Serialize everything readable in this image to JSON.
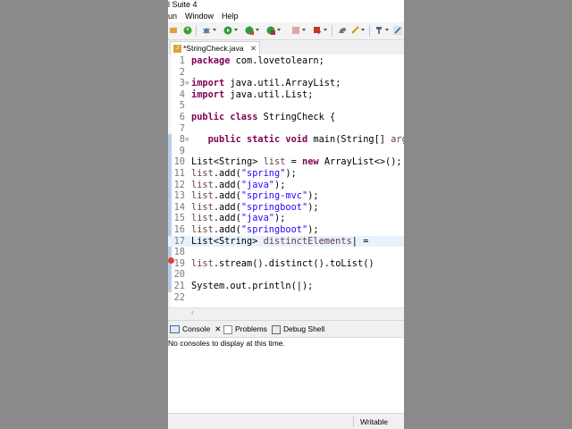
{
  "window": {
    "title": "l Suite 4"
  },
  "menu": [
    "un",
    "Window",
    "Help"
  ],
  "editor": {
    "tab_label": "*StringCheck.java",
    "lines": [
      {
        "n": "1",
        "html": "<span class=\"kw\">package</span> com.lovetolearn;"
      },
      {
        "n": "2",
        "html": ""
      },
      {
        "n": "3",
        "html": "<span class=\"kw\">import</span> java.util.ArrayList;"
      },
      {
        "n": "4",
        "html": "<span class=\"kw\">import</span> java.util.List;"
      },
      {
        "n": "5",
        "html": ""
      },
      {
        "n": "6",
        "html": "<span class=\"kw\">public class</span> StringCheck {"
      },
      {
        "n": "7",
        "html": ""
      },
      {
        "n": "8",
        "html": "   <span class=\"kw\">public static void</span> main(String[] <span class=\"var\">arg</span>"
      },
      {
        "n": "9",
        "html": ""
      },
      {
        "n": "10",
        "html": "List&lt;String&gt; <span class=\"var\">list</span> = <span class=\"kw\">new</span> ArrayList&lt;&gt;();"
      },
      {
        "n": "11",
        "html": "<span class=\"var\">list</span>.add(<span class=\"str\">\"spring\"</span>);"
      },
      {
        "n": "12",
        "html": "<span class=\"var\">list</span>.add(<span class=\"str\">\"java\"</span>);"
      },
      {
        "n": "13",
        "html": "<span class=\"var\">list</span>.add(<span class=\"str\">\"spring-mvc\"</span>);"
      },
      {
        "n": "14",
        "html": "<span class=\"var\">list</span>.add(<span class=\"str\">\"springboot\"</span>);"
      },
      {
        "n": "15",
        "html": "<span class=\"var\">list</span>.add(<span class=\"str\">\"java\"</span>);"
      },
      {
        "n": "16",
        "html": "<span class=\"var\">list</span>.add(<span class=\"str\">\"springboot\"</span>);"
      },
      {
        "n": "17",
        "html": "List&lt;String&gt; <span class=\"var\">distinctElements</span>| ="
      },
      {
        "n": "18",
        "html": ""
      },
      {
        "n": "19",
        "html": "<span class=\"var\">list</span>.stream().distinct().toList()"
      },
      {
        "n": "20",
        "html": ""
      },
      {
        "n": "21",
        "html": "System.out.println(|);"
      },
      {
        "n": "22",
        "html": ""
      }
    ]
  },
  "console": {
    "tabs": [
      "Console",
      "Problems",
      "Debug Shell"
    ],
    "message": "No consoles to display at this time."
  },
  "status": {
    "writable": "Writable"
  }
}
